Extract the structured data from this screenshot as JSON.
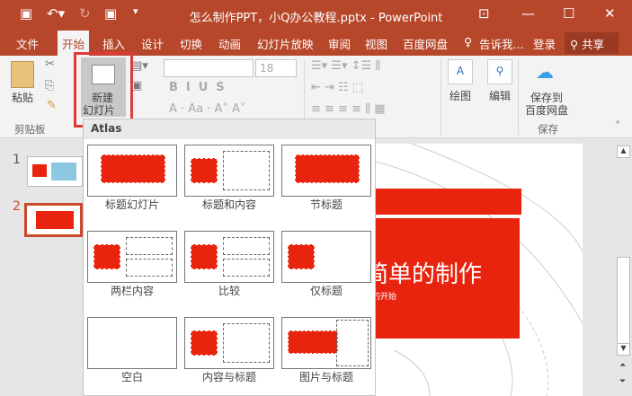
{
  "window": {
    "title": "怎么制作PPT，小Q办公教程.pptx - PowerPoint"
  },
  "tabs": [
    "文件",
    "开始",
    "插入",
    "设计",
    "切换",
    "动画",
    "幻灯片放映",
    "审阅",
    "视图",
    "百度网盘"
  ],
  "tell_me": "告诉我...",
  "login": "登录",
  "share": "共享",
  "ribbon": {
    "paste": "粘贴",
    "new_slide_1": "新建",
    "new_slide_2": "幻灯片",
    "font_size": "18",
    "draw": "绘图",
    "edit": "编辑",
    "save_to_1": "保存到",
    "save_to_2": "百度网盘",
    "group_clipboard": "剪贴板",
    "group_save": "保存"
  },
  "slides": [
    "1",
    "2"
  ],
  "dropdown": {
    "theme": "Atlas",
    "layouts": [
      "标题幻灯片",
      "标题和内容",
      "节标题",
      "两栏内容",
      "比较",
      "仅标题",
      "空白",
      "内容与标题",
      "图片与标题"
    ]
  },
  "slide": {
    "title": "简单的制作",
    "subtitle": "的开始"
  },
  "colors": {
    "accent": "#b7472a",
    "red": "#e8240f"
  }
}
